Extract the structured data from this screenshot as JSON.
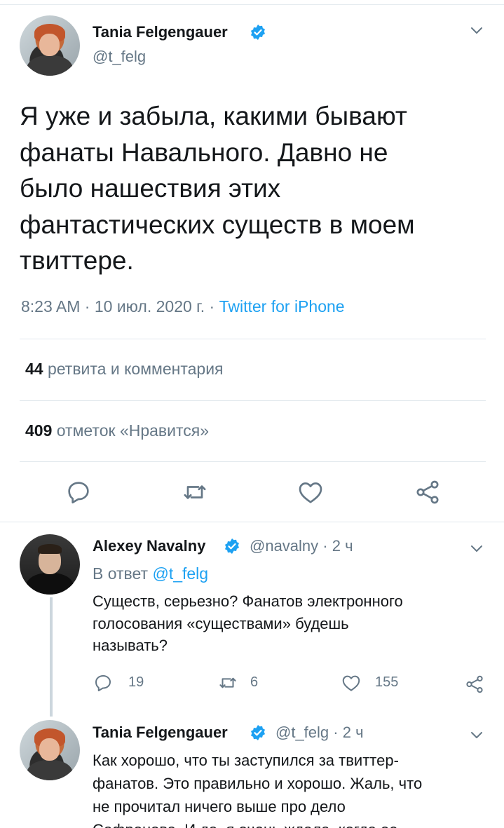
{
  "main_tweet": {
    "author_name": "Tania Felgengauer",
    "author_handle": "@t_felg",
    "text_lines": [
      "Я уже и забыла, какими бывают",
      "фанаты Навального. Давно не",
      "было нашествия этих",
      "фантастических существ в моем",
      "твиттере."
    ],
    "time": "8:23 AM",
    "date": "10 июл. 2020 г.",
    "source": "Twitter for iPhone",
    "retweets_count": "44",
    "retweets_label": "ретвита и комментария",
    "likes_count": "409",
    "likes_label": "отметок «Нравится»"
  },
  "replies": [
    {
      "author_name": "Alexey Navalny",
      "author_handle": "@navalny",
      "time": "2 ч",
      "reply_prefix": "В ответ",
      "reply_to": "@t_felg",
      "text_lines": [
        "Существ, серьезно? Фанатов электронного",
        "голосования «существами» будешь",
        "называть?"
      ],
      "replies_count": "19",
      "retweets_count": "6",
      "likes_count": "155"
    },
    {
      "author_name": "Tania Felgengauer",
      "author_handle": "@t_felg",
      "time": "2 ч",
      "text_lines": [
        "Как хорошо, что ты заступился за твиттер-",
        "фанатов. Это правильно и хорошо. Жаль, что",
        "не прочитал ничего выше про дело",
        "Сафронова. И да, я очень ждала, когда ее"
      ]
    }
  ],
  "sep": " · ",
  "icons": [
    "verified-badge-icon",
    "chevron-down-icon",
    "reply-icon",
    "retweet-icon",
    "like-icon",
    "share-icon"
  ],
  "colors": {
    "accent": "#1da1f2",
    "text": "#14171a",
    "muted": "#657786",
    "divider": "#e1e8ed"
  }
}
